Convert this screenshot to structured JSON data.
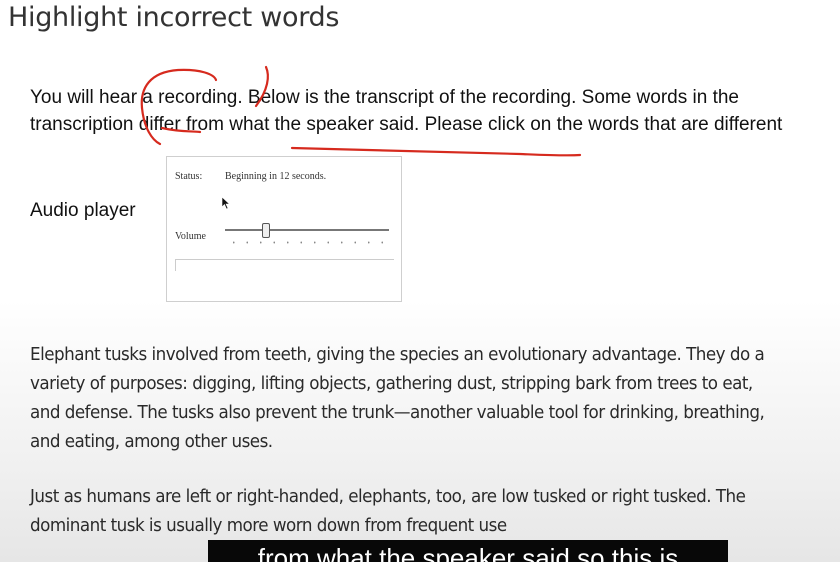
{
  "page": {
    "title": "Highlight incorrect words"
  },
  "instructions": {
    "text": "You will hear a recording. Below is the transcript of the recording. Some words in the transcription differ from what the speaker said.  Please click on the words that are different"
  },
  "audio_player": {
    "label": "Audio player",
    "status_label": "Status:",
    "status_value": "Beginning in 12 seconds.",
    "volume_label": "Volume",
    "volume_level": 0.25
  },
  "passage": {
    "paragraphs": [
      "Elephant tusks involved from teeth, giving the species an evolutionary advantage. They do a variety of purposes: digging, lifting objects, gathering dust, stripping bark from trees to eat, and defense. The tusks also prevent the trunk—another valuable tool for drinking, breathing, and eating, among other uses.",
      "Just as humans are left or right-handed, elephants, too, are low tusked or right tusked. The dominant tusk is usually more worn down from frequent use"
    ]
  },
  "caption": {
    "text": "from what the speaker said so this is"
  },
  "colors": {
    "annotation_red": "#d62a1e",
    "caption_bg": "#080808"
  }
}
